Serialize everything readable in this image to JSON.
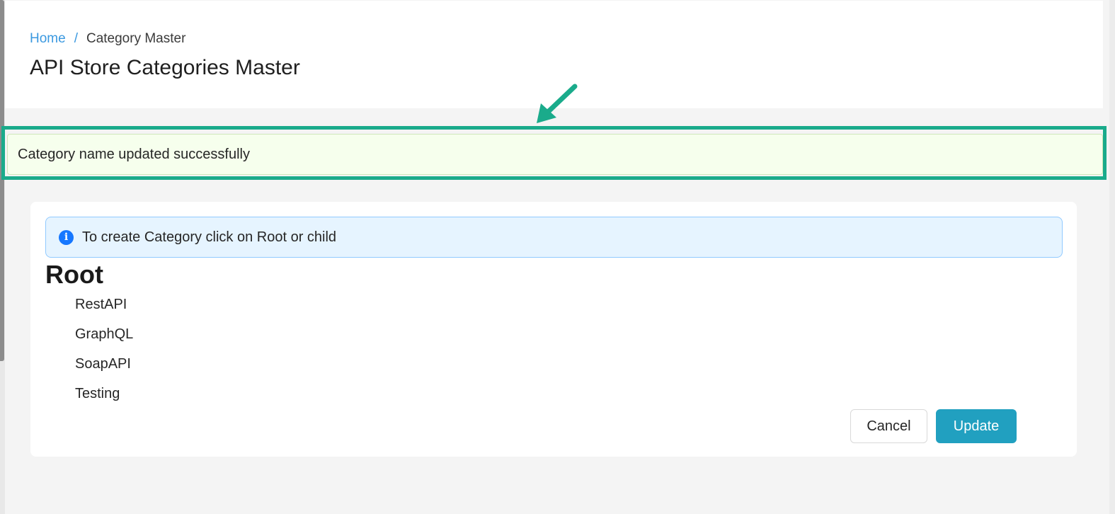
{
  "breadcrumb": {
    "home": "Home",
    "separator": "/",
    "current": "Category Master"
  },
  "page_title": "API Store Categories Master",
  "success_alert": {
    "message": "Category name updated successfully",
    "highlight_color": "#1aab8b"
  },
  "info_alert": {
    "icon": "info-icon",
    "icon_glyph": "i",
    "message": "To create Category click on Root or child"
  },
  "tree": {
    "root": "Root",
    "children": [
      "RestAPI",
      "GraphQL",
      "SoapAPI",
      "Testing"
    ]
  },
  "buttons": {
    "cancel": "Cancel",
    "update": "Update",
    "update_color": "#21a0c0"
  }
}
